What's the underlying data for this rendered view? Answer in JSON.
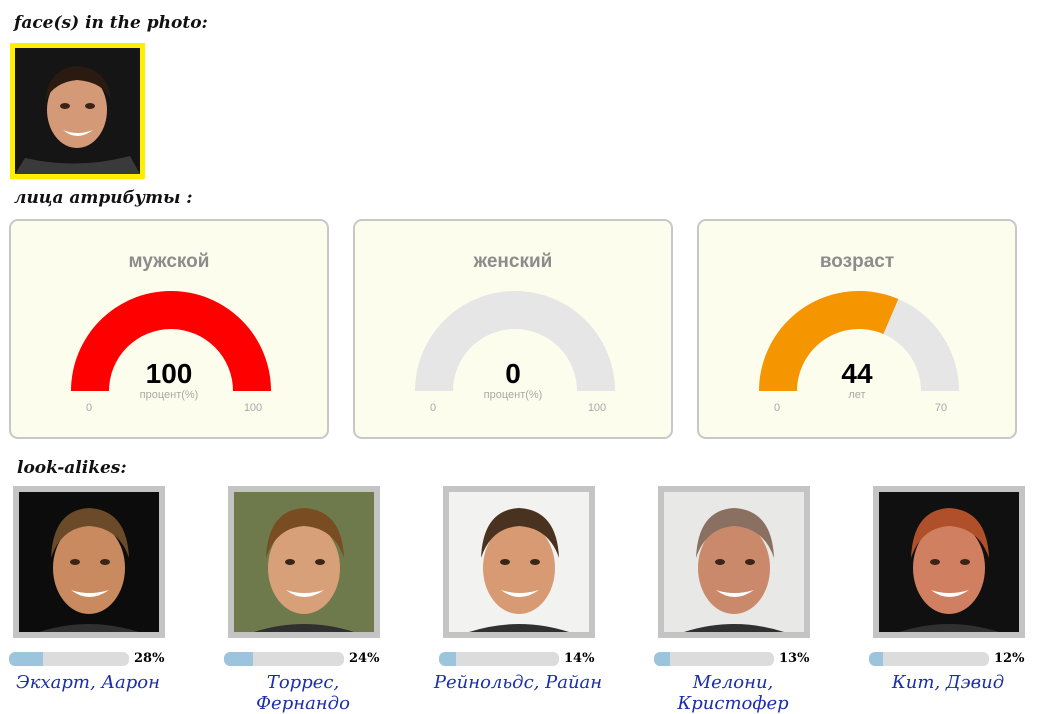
{
  "headings": {
    "faces": "face(s) in the photo:",
    "attributes": "лица атрибуты :",
    "lookalikes": "look-alikes:"
  },
  "gauges": [
    {
      "title": "мужской",
      "value": "100",
      "unit": "процент(%)",
      "min": "0",
      "max": "100",
      "fraction": 1.0,
      "color": "#ff0000"
    },
    {
      "title": "женский",
      "value": "0",
      "unit": "процент(%)",
      "min": "0",
      "max": "100",
      "fraction": 0.0,
      "color": "#ff0000"
    },
    {
      "title": "возраст",
      "value": "44",
      "unit": "лет",
      "min": "0",
      "max": "70",
      "fraction": 0.6286,
      "color": "#f59500"
    }
  ],
  "gauge_track_color": "#e6e6e6",
  "lookalikes": [
    {
      "name": "Экхарт, Аарон",
      "percent": "28%",
      "fraction": 0.28,
      "bg": "#0c0c0c",
      "skin": "#c98a60",
      "hair": "#6b4a2a"
    },
    {
      "name": "Торрес, Фернандо",
      "percent": "24%",
      "fraction": 0.24,
      "bg": "#6e7a4c",
      "skin": "#d8a078",
      "hair": "#7a4c22"
    },
    {
      "name": "Рейнольдс, Райан",
      "percent": "14%",
      "fraction": 0.14,
      "bg": "#f2f2f0",
      "skin": "#d79a72",
      "hair": "#4a3220"
    },
    {
      "name": "Мелони, Кристофер",
      "percent": "13%",
      "fraction": 0.13,
      "bg": "#e8e8e6",
      "skin": "#c9896a",
      "hair": "#8a7060"
    },
    {
      "name": "Кит, Дэвид",
      "percent": "12%",
      "fraction": 0.12,
      "bg": "#101010",
      "skin": "#d08060",
      "hair": "#b0502a"
    }
  ]
}
